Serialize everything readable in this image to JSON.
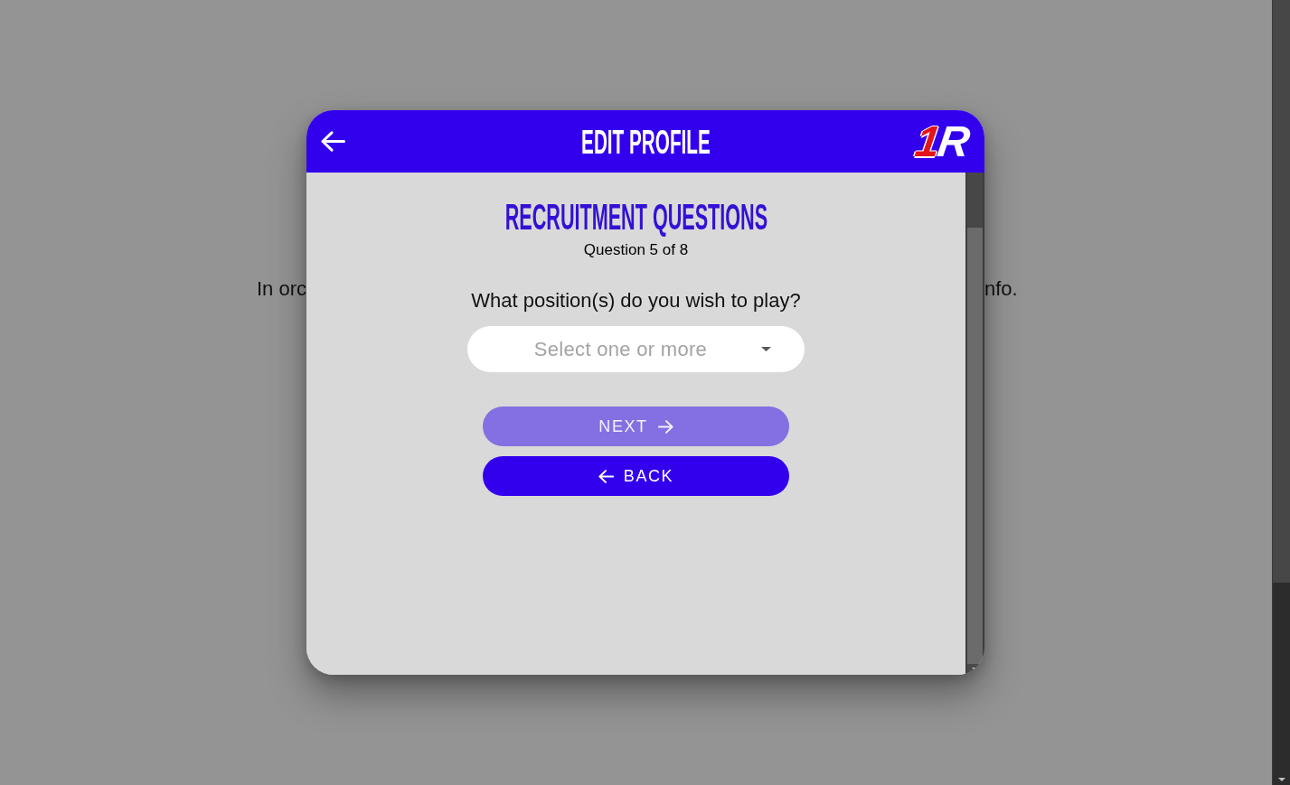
{
  "page": {
    "text_fragments": [
      "In orc",
      "nfo."
    ]
  },
  "modal": {
    "title": "EDIT PROFILE",
    "logo": [
      {
        "text": "1",
        "color": "#e3141b"
      },
      {
        "text": "R",
        "color": "#ffffff"
      }
    ]
  },
  "section": {
    "heading": "RECRUITMENT QUESTIONS",
    "progress": "Question 5 of 8",
    "question": "What position(s) do you wish to play?",
    "select": {
      "placeholder": "Select one or more"
    }
  },
  "buttons": [
    {
      "label": "NEXT",
      "kind": "next",
      "disabled": true
    },
    {
      "label": "BACK",
      "kind": "back",
      "disabled": false
    }
  ]
}
